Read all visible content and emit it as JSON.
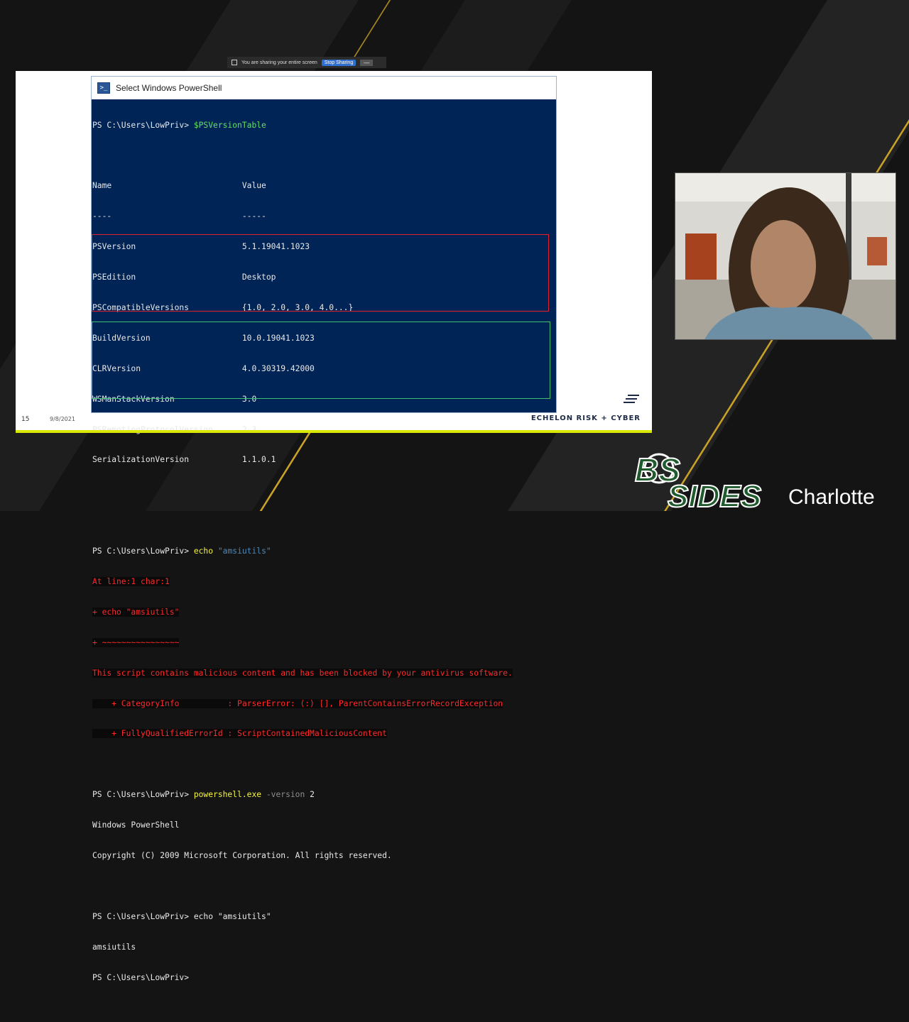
{
  "share_bar": {
    "message": "You are sharing your entire screen",
    "stop_label": "Stop Sharing",
    "minimize_label": "—"
  },
  "window": {
    "title": "Select Windows PowerShell"
  },
  "console": {
    "prompt": "PS C:\\Users\\LowPriv> ",
    "cmd1": "$PSVersionTable",
    "table_header": "Name                           Value",
    "table_rule": "----                           -----",
    "rows": [
      "PSVersion                      5.1.19041.1023",
      "PSEdition                      Desktop",
      "PSCompatibleVersions           {1.0, 2.0, 3.0, 4.0...}",
      "BuildVersion                   10.0.19041.1023",
      "CLRVersion                     4.0.30319.42000",
      "WSManStackVersion              3.0",
      "PSRemotingProtocolVersion      2.3",
      "SerializationVersion           1.1.0.1"
    ],
    "cmd2_kw": "echo",
    "cmd2_arg": "\"amsiutils\"",
    "errors": [
      "At line:1 char:1",
      "+ echo \"amsiutils\"",
      "+ ~~~~~~~~~~~~~~~~",
      "This script contains malicious content and has been blocked by your antivirus software.",
      "    + CategoryInfo          : ParserError: (:) [], ParentContainsErrorRecordException",
      "    + FullyQualifiedErrorId : ScriptContainedMaliciousContent"
    ],
    "cmd3_kw": "powershell.exe",
    "cmd3_param": "-version",
    "cmd3_val": "2",
    "out3": [
      "Windows PowerShell",
      "Copyright (C) 2009 Microsoft Corporation. All rights reserved."
    ],
    "cmd4": "echo \"amsiutils\"",
    "out4": "amsiutils",
    "final_prompt": "PS C:\\Users\\LowPriv>"
  },
  "slide": {
    "number": "15",
    "date": "9/8/2021",
    "brand": "ECHELON RISK + CYBER"
  },
  "event_logo": {
    "name": "BSIDES",
    "city": "Charlotte"
  },
  "colors": {
    "console_bg": "#012456",
    "error_red": "#ff2a2a",
    "accent_yellow": "#d8e800",
    "logo_green": "#1f5b2c"
  }
}
